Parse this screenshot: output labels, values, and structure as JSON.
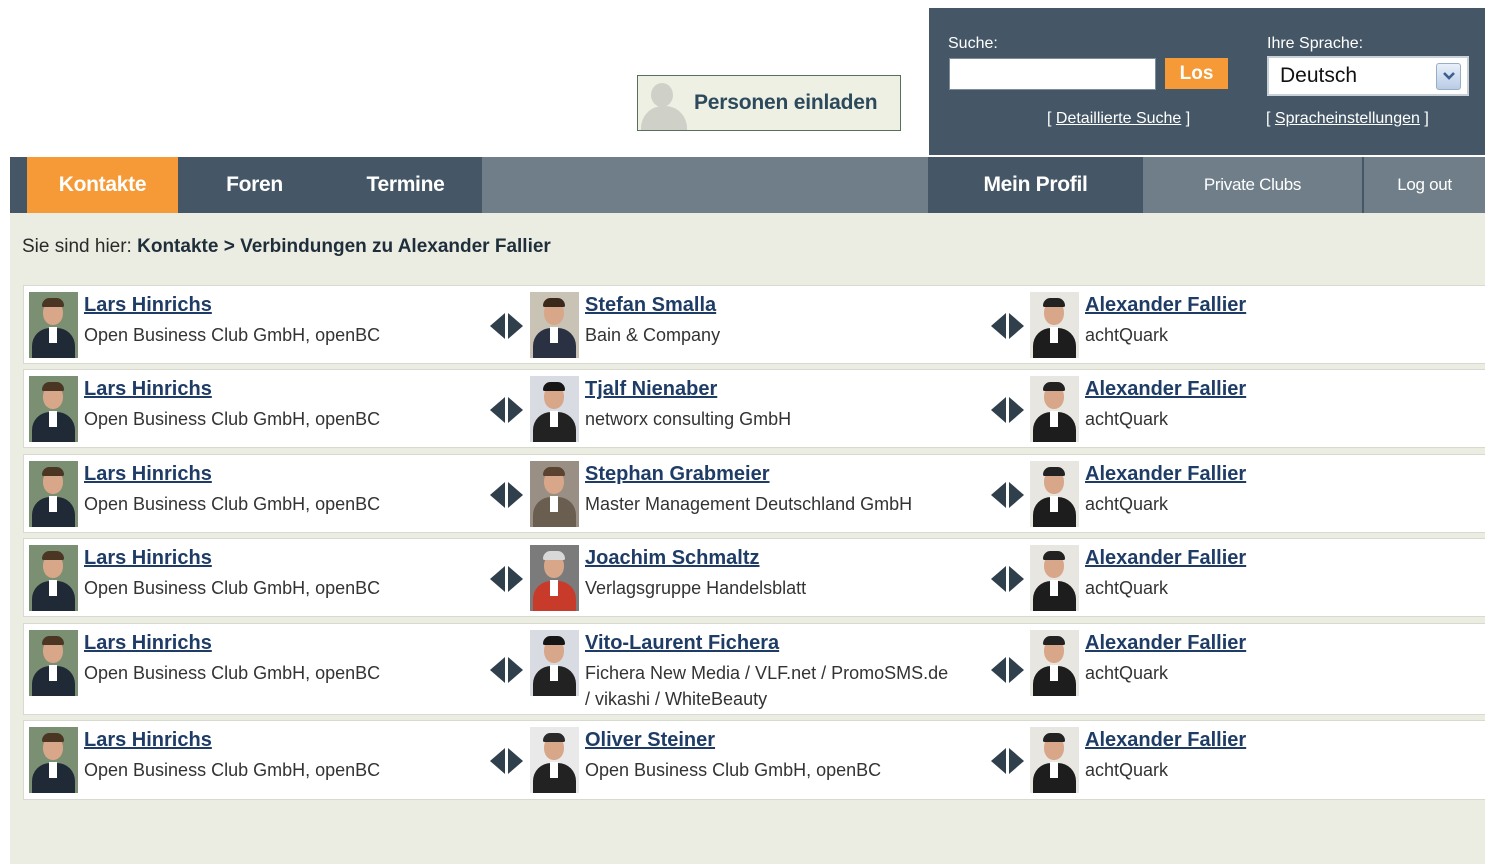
{
  "header": {
    "invite_label": "Personen einladen",
    "search_label": "Suche:",
    "search_value": "",
    "search_button": "Los",
    "language_label": "Ihre Sprache:",
    "language_value": "Deutsch",
    "detailed_search_link": "Detaillierte Suche",
    "language_settings_link": "Spracheinstellungen",
    "bracket_open": "[",
    "bracket_close": "]"
  },
  "nav": {
    "tabs": [
      "Kontakte",
      "Foren",
      "Termine"
    ],
    "right": [
      "Mein Profil",
      "Private Clubs",
      "Log out"
    ],
    "active": "Kontakte"
  },
  "breadcrumb": {
    "prefix": "Sie sind hier:",
    "path": "Kontakte > Verbindungen zu Alexander Fallier"
  },
  "connections": [
    {
      "from": {
        "name": "Lars Hinrichs",
        "company": "Open Business Club GmbH, openBC"
      },
      "via": {
        "name": "Stefan Smalla",
        "company": "Bain & Company"
      },
      "to": {
        "name": "Alexander Fallier",
        "company": "achtQuark"
      }
    },
    {
      "from": {
        "name": "Lars Hinrichs",
        "company": "Open Business Club GmbH, openBC"
      },
      "via": {
        "name": "Tjalf Nienaber",
        "company": "networx consulting GmbH"
      },
      "to": {
        "name": "Alexander Fallier",
        "company": "achtQuark"
      }
    },
    {
      "from": {
        "name": "Lars Hinrichs",
        "company": "Open Business Club GmbH, openBC"
      },
      "via": {
        "name": "Stephan Grabmeier",
        "company": "Master Management Deutschland GmbH"
      },
      "to": {
        "name": "Alexander Fallier",
        "company": "achtQuark"
      }
    },
    {
      "from": {
        "name": "Lars Hinrichs",
        "company": "Open Business Club GmbH, openBC"
      },
      "via": {
        "name": "Joachim Schmaltz",
        "company": "Verlagsgruppe Handelsblatt"
      },
      "to": {
        "name": "Alexander Fallier",
        "company": "achtQuark"
      }
    },
    {
      "from": {
        "name": "Lars Hinrichs",
        "company": "Open Business Club GmbH, openBC"
      },
      "via": {
        "name": "Vito-Laurent Fichera",
        "company": "Fichera New Media / VLF.net / PromoSMS.de / vikashi / WhiteBeauty"
      },
      "to": {
        "name": "Alexander Fallier",
        "company": "achtQuark"
      }
    },
    {
      "from": {
        "name": "Lars Hinrichs",
        "company": "Open Business Club GmbH, openBC"
      },
      "via": {
        "name": "Oliver Steiner",
        "company": "Open Business Club GmbH, openBC"
      },
      "to": {
        "name": "Alexander Fallier",
        "company": "achtQuark"
      }
    }
  ],
  "colors": {
    "nav_bg": "#455766",
    "active_tab": "#f59a37",
    "link": "#1e3c66",
    "content_bg": "#ecede2"
  },
  "icons": {
    "connection": "bidirectional-arrow-icon",
    "invite": "person-silhouette-icon",
    "dropdown": "chevron-down-icon"
  }
}
